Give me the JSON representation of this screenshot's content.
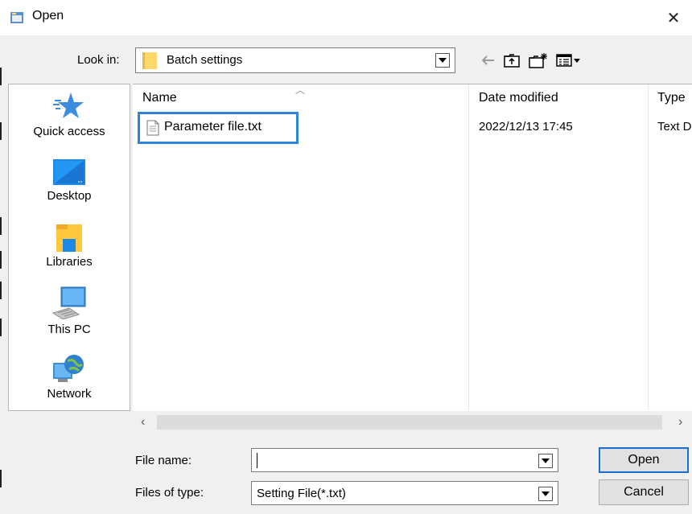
{
  "window": {
    "title": "Open",
    "close_glyph": "✕"
  },
  "look_in": {
    "label": "Look in:",
    "value": "Batch settings"
  },
  "toolbar": {
    "back_icon": "back-arrow-icon",
    "up_icon": "up-folder-icon",
    "new_folder_icon": "new-folder-icon",
    "view_icon": "view-menu-icon"
  },
  "places": [
    {
      "label": "Quick access",
      "icon": "star-icon"
    },
    {
      "label": "Desktop",
      "icon": "desktop-icon"
    },
    {
      "label": "Libraries",
      "icon": "libraries-icon"
    },
    {
      "label": "This PC",
      "icon": "computer-icon"
    },
    {
      "label": "Network",
      "icon": "network-icon"
    }
  ],
  "file_list": {
    "columns": [
      "Name",
      "Date modified",
      "Type"
    ],
    "rows": [
      {
        "name": "Parameter file.txt",
        "date": "2022/12/13 17:45",
        "type": "Text D"
      }
    ]
  },
  "file_name": {
    "label": "File name:",
    "value": ""
  },
  "files_of_type": {
    "label": "Files of type:",
    "value": "Setting File(*.txt)"
  },
  "buttons": {
    "open": "Open",
    "cancel": "Cancel"
  },
  "colors": {
    "selection_border": "#2f86d6",
    "accent": "#1a6fd0"
  }
}
